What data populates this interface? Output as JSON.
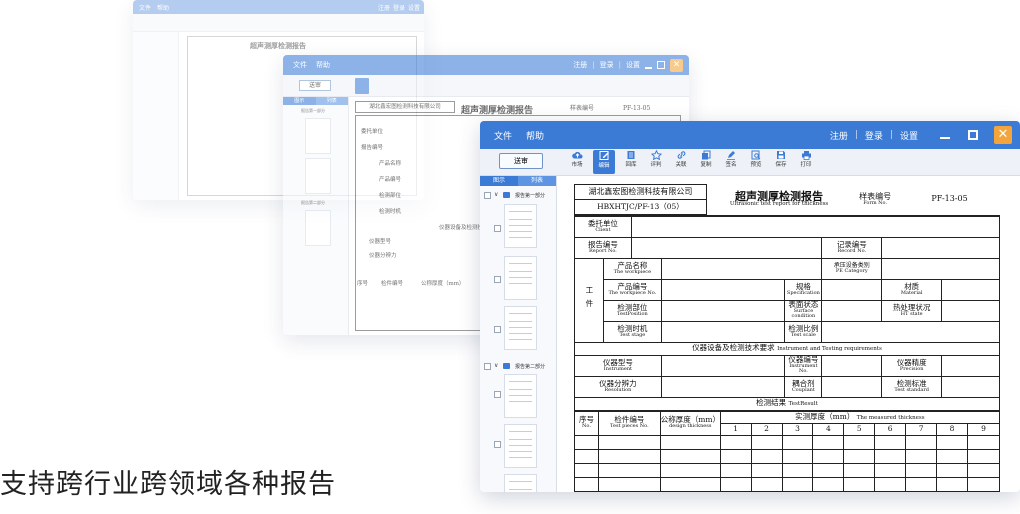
{
  "caption": "支持跨行业跨领域各种报告",
  "menu": {
    "file": "文件",
    "help": "帮助"
  },
  "account": {
    "register": "注册",
    "login": "登录",
    "settings": "设置",
    "sep": "|"
  },
  "window_buttons": {
    "close": "✕"
  },
  "main_button": "送审",
  "toolbar": [
    {
      "label": "市场",
      "icon": "cloud-upload-icon"
    },
    {
      "label": "编辑",
      "icon": "edit-icon",
      "active": true
    },
    {
      "label": "回库",
      "icon": "library-icon"
    },
    {
      "label": "评判",
      "icon": "star-icon"
    },
    {
      "label": "关联",
      "icon": "link-icon"
    },
    {
      "label": "复制",
      "icon": "copy-icon"
    },
    {
      "label": "签名",
      "icon": "pen-icon"
    },
    {
      "label": "预览",
      "icon": "preview-icon"
    },
    {
      "label": "保存",
      "icon": "save-icon"
    },
    {
      "label": "打印",
      "icon": "print-icon"
    }
  ],
  "sidebar": {
    "tabs": [
      "图示",
      "列表"
    ],
    "group1": "报告第一部分",
    "group2": "报告第二部分"
  },
  "report": {
    "company": "湖北鑫宏图检测科技有限公司",
    "code": "HBXHTJC/PF-13（05）",
    "title": "超声测厚检测报告",
    "title_en": "Ultrasonic test report for thickness",
    "form_no_cn": "样表编号",
    "form_no_en": "Form No.",
    "form_no": "PF-13-05",
    "client_cn": "委托单位",
    "client_en": "Client",
    "report_no_cn": "报告编号",
    "report_no_en": "Report No.",
    "record_no_cn": "记录编号",
    "record_no_en": "Record No.",
    "workpiece_label": "工件",
    "product_name_cn": "产品名称",
    "product_name_en": "The workpiece",
    "pe_cat_cn": "承压设备类别",
    "pe_cat_en": "PE Category",
    "product_no_cn": "产品编号",
    "product_no_en": "The workpiece No.",
    "spec_cn": "规格",
    "spec_en": "Specification",
    "material_cn": "材质",
    "material_en": "Material",
    "position_cn": "检测部位",
    "position_en": "TestPosition",
    "surface_cn": "表面状态",
    "surface_en": "Surface condition",
    "ht_cn": "热处理状况",
    "ht_en": "HT state",
    "stage_cn": "检测时机",
    "stage_en": "Test stage",
    "scale_cn": "检测比例",
    "scale_en": "Test scale",
    "equip_title": "仪器设备及检测技术要求",
    "equip_title_en": "Instrument and Testing requirements",
    "inst_model_cn": "仪器型号",
    "inst_model_en": "Instrument",
    "inst_no_cn": "仪器编号",
    "inst_no_en": "Instrument No.",
    "precision_cn": "仪器精度",
    "precision_en": "Precision",
    "resolution_cn": "仪器分辨力",
    "resolution_en": "Resolution",
    "couplant_cn": "耦合剂",
    "couplant_en": "Couplant",
    "standard_cn": "检测标准",
    "standard_en": "Test standard",
    "result_title": "检测结果",
    "result_title_en": "TestResult",
    "seq_cn": "序号",
    "seq_en": "No.",
    "piece_no_cn": "检件编号",
    "piece_no_en": "Test pieces No.",
    "nominal_cn": "公称厚度（mm）",
    "nominal_en": "design thickness",
    "measured_cn": "实测厚度（mm）",
    "measured_en": "The measured thickness",
    "cols": [
      "1",
      "2",
      "3",
      "4",
      "5",
      "6",
      "7",
      "8",
      "9"
    ]
  }
}
